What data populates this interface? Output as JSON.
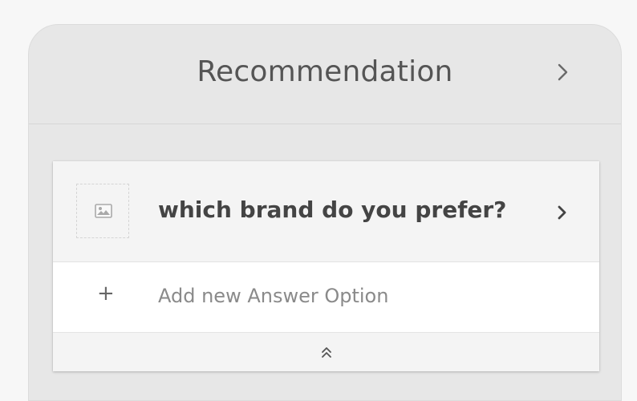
{
  "card": {
    "title": "Recommendation",
    "header_icon": "chevron-right-icon"
  },
  "question": {
    "text": "which brand do you prefer?",
    "image_icon": "image-placeholder-icon",
    "chevron_icon": "chevron-right-icon"
  },
  "answer_options": {
    "add_icon": "plus-icon",
    "add_label": "Add new Answer Option"
  },
  "collapse": {
    "icon": "double-chevron-up-icon"
  },
  "colors": {
    "card_background": "#e7e7e7",
    "question_background": "#f4f4f4",
    "title_text": "#555555",
    "question_text": "#444444",
    "muted_text": "#8a8a8a"
  }
}
